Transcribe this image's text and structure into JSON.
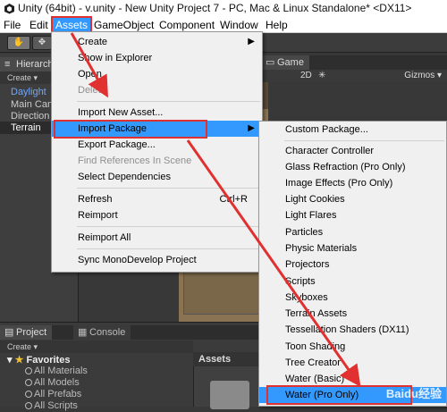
{
  "window": {
    "title": "Unity (64bit) - v.unity - New Unity Project 7 - PC, Mac & Linux Standalone* <DX11>"
  },
  "menubar": {
    "items": [
      "File",
      "Edit",
      "Assets",
      "GameObject",
      "Component",
      "Window",
      "Help"
    ]
  },
  "hierarchy": {
    "tab": "Hierarch",
    "create": "Create ▾",
    "items": [
      "Daylight",
      "Main Cam",
      "Direction",
      "Terrain"
    ]
  },
  "game": {
    "tab": "Game",
    "mode": "2D",
    "gizmos": "Gizmos ▾"
  },
  "project": {
    "tab": "Project",
    "console_tab": "Console",
    "create": "Create ▾",
    "favorites": "Favorites",
    "fav_items": [
      "All Materials",
      "All Models",
      "All Prefabs",
      "All Scripts"
    ],
    "assets_label": "Assets"
  },
  "assets_menu": {
    "items": [
      {
        "label": "Create",
        "submenu": true
      },
      {
        "label": "Show in Explorer"
      },
      {
        "label": "Open"
      },
      {
        "label": "Delete",
        "disabled": true
      },
      {
        "label": "Import New Asset..."
      },
      {
        "label": "Import Package",
        "submenu": true,
        "highlighted": true
      },
      {
        "label": "Export Package..."
      },
      {
        "label": "Find References In Scene",
        "disabled": true
      },
      {
        "label": "Select Dependencies"
      },
      {
        "label": "Refresh",
        "shortcut": "Ctrl+R"
      },
      {
        "label": "Reimport"
      },
      {
        "label": "Reimport All"
      },
      {
        "label": "Sync MonoDevelop Project"
      }
    ]
  },
  "package_menu": {
    "items": [
      {
        "label": "Custom Package..."
      },
      {
        "label": "Character Controller"
      },
      {
        "label": "Glass Refraction (Pro Only)"
      },
      {
        "label": "Image Effects (Pro Only)"
      },
      {
        "label": "Light Cookies"
      },
      {
        "label": "Light Flares"
      },
      {
        "label": "Particles"
      },
      {
        "label": "Physic Materials"
      },
      {
        "label": "Projectors"
      },
      {
        "label": "Scripts"
      },
      {
        "label": "Skyboxes"
      },
      {
        "label": "Terrain Assets"
      },
      {
        "label": "Tessellation Shaders (DX11)"
      },
      {
        "label": "Toon Shading"
      },
      {
        "label": "Tree Creator"
      },
      {
        "label": "Water (Basic)"
      },
      {
        "label": "Water (Pro Only)",
        "highlighted": true
      }
    ]
  },
  "watermark": "Baidu经验",
  "colors": {
    "highlight": "#3399ff",
    "annotation": "#e03030"
  }
}
